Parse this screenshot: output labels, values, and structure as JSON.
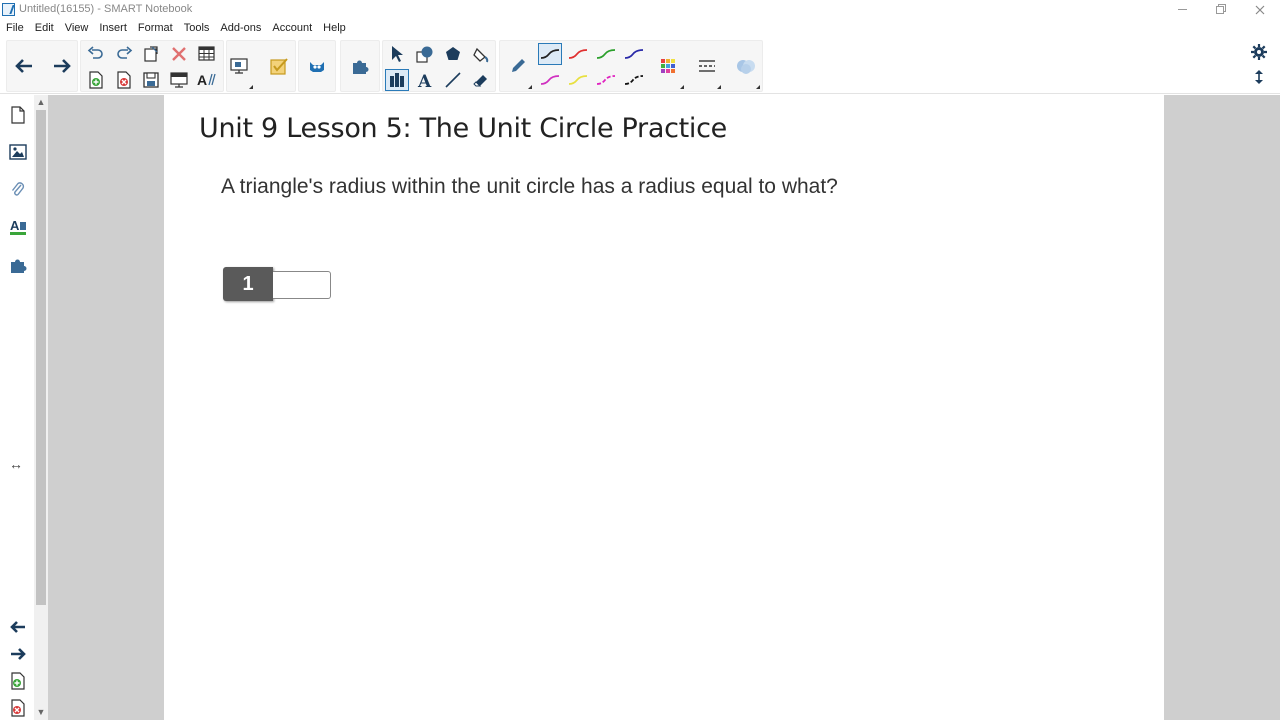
{
  "window": {
    "title": "Untitled(16155) - SMART Notebook"
  },
  "menu": [
    {
      "label": "File"
    },
    {
      "label": "Edit"
    },
    {
      "label": "View"
    },
    {
      "label": "Insert"
    },
    {
      "label": "Format"
    },
    {
      "label": "Tools"
    },
    {
      "label": "Add-ons"
    },
    {
      "label": "Account"
    },
    {
      "label": "Help"
    }
  ],
  "toolbar": {
    "pen_colors": [
      "#222222",
      "#e03030",
      "#2ca02c",
      "#2a2aa8",
      "#d030c0",
      "#e8e040",
      "#e020c0",
      "#111111"
    ]
  },
  "page": {
    "title": "Unit 9 Lesson 5: The Unit Circle Practice",
    "question": "A triangle's radius within the unit circle has a radius equal to what?",
    "answer_label": "1",
    "answer_value": ""
  }
}
